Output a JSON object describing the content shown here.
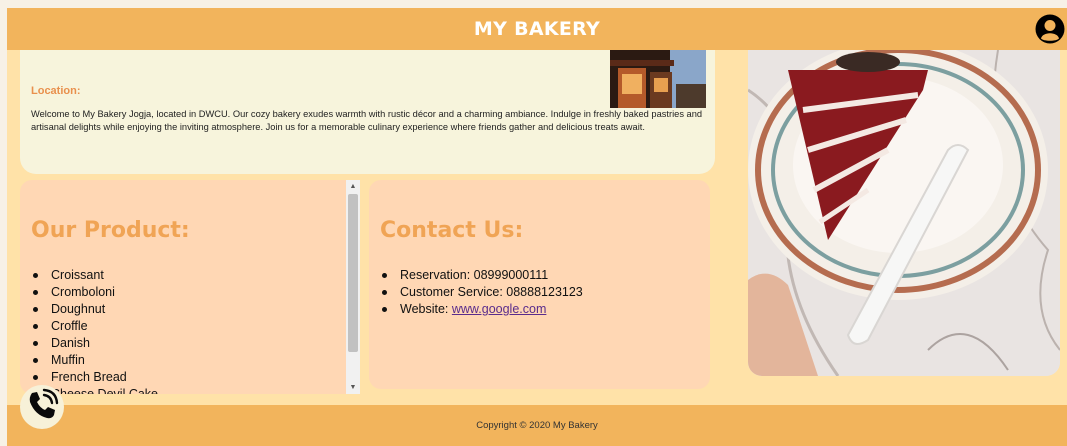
{
  "header": {
    "title": "MY BAKERY",
    "avatar_icon": "user-avatar-icon"
  },
  "location": {
    "title": "Location:",
    "text": "Welcome to My Bakery Jogja, located in DWCU. Our cozy bakery exudes warmth with rustic décor and a charming ambiance. Indulge in freshly baked pastries and artisanal delights while enjoying the inviting atmosphere. Join us for a memorable culinary experience where friends gather and delicious treats await."
  },
  "products": {
    "title": "Our Product:",
    "items": [
      "Croissant",
      "Cromboloni",
      "Doughnut",
      "Croffle",
      "Danish",
      "Muffin",
      "French Bread",
      "Cheese Devil Cake"
    ]
  },
  "contact": {
    "title": "Contact Us:",
    "reservation": "Reservation: 08999000111",
    "customer_service": "Customer Service: 08888123123",
    "website_label": "Website: ",
    "website_link": "www.google.com"
  },
  "footer": {
    "copyright": "Copyright © 2020 My Bakery"
  },
  "call_button_icon": "phone-icon",
  "colors": {
    "header": "#f2b45c",
    "page_background": "#ffe2a8",
    "card_peach": "#ffd7b4",
    "card_cream": "#f7f4dc",
    "heading_orange": "#f0a455"
  }
}
